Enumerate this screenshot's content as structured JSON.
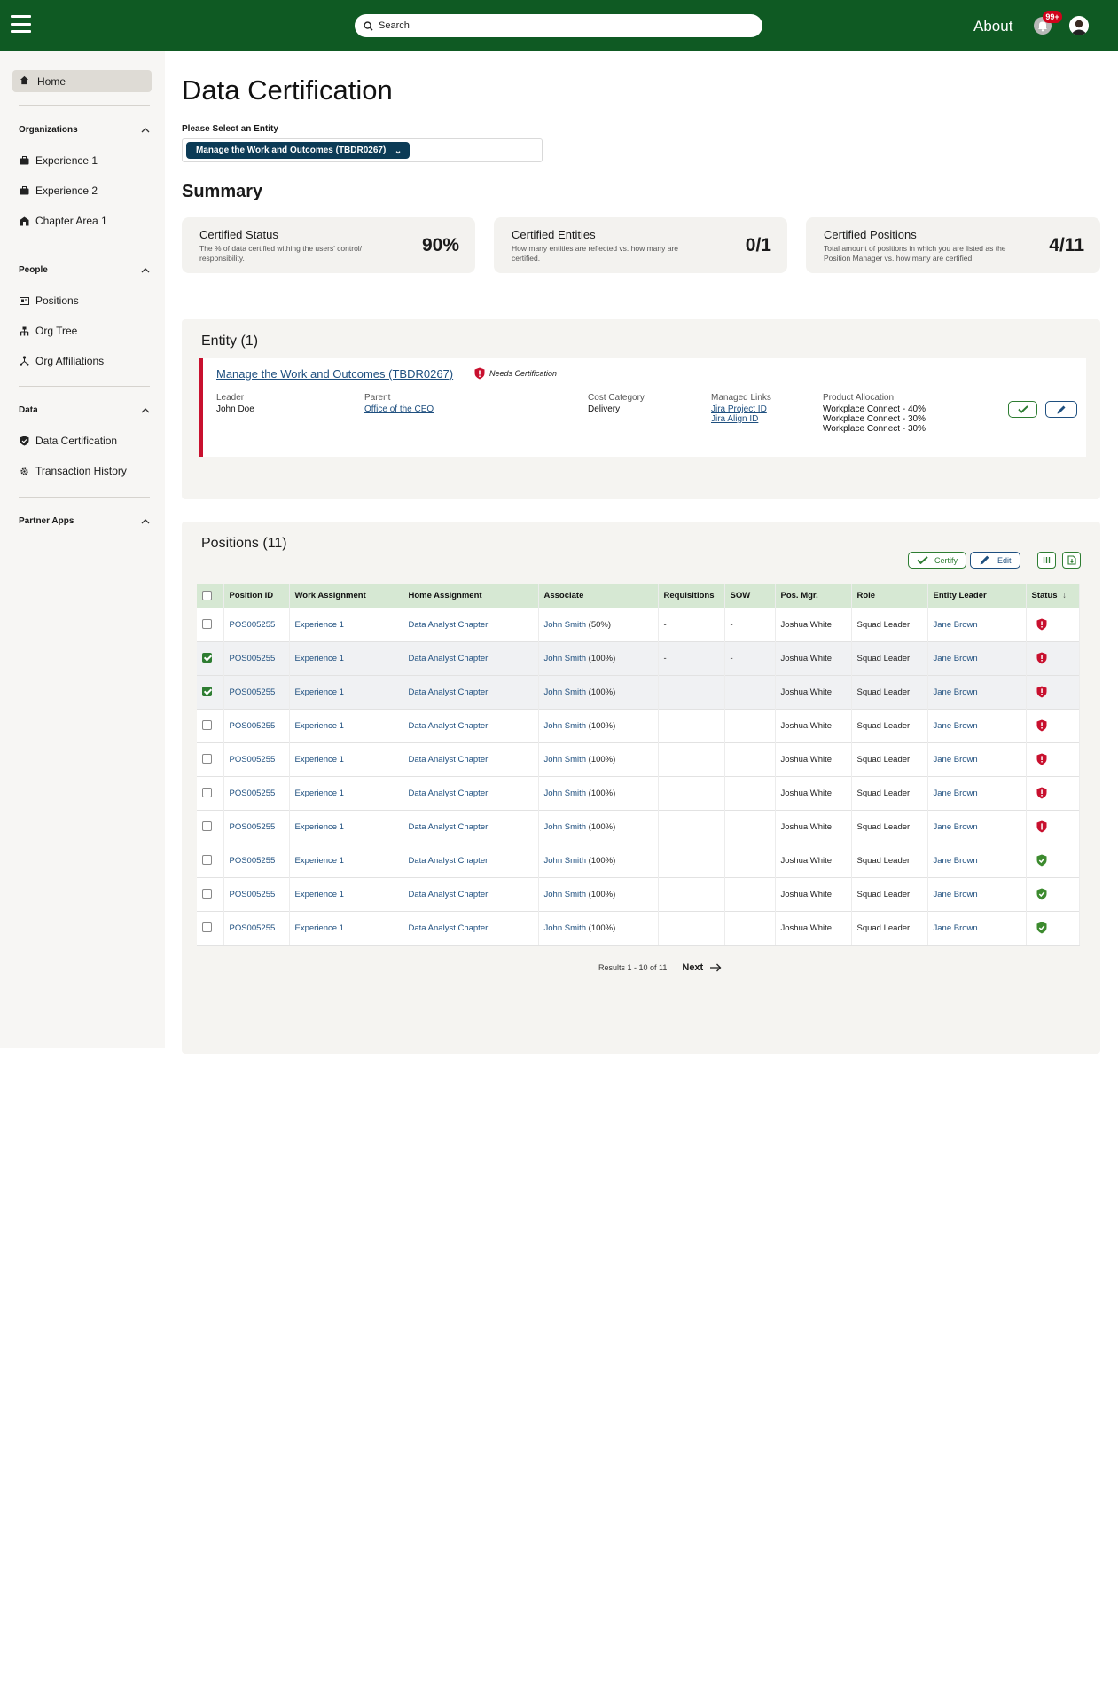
{
  "header": {
    "search_placeholder": "Search",
    "about_label": "About",
    "notification_count": "99+"
  },
  "sidebar": {
    "home_label": "Home",
    "sections": [
      {
        "title": "Organizations",
        "items": [
          "Experience 1",
          "Experience 2",
          "Chapter Area 1"
        ]
      },
      {
        "title": "People",
        "items": [
          "Positions",
          "Org Tree",
          "Org Affiliations"
        ]
      },
      {
        "title": "Data",
        "items": [
          "Data Certification",
          "Transaction History"
        ]
      },
      {
        "title": "Partner Apps",
        "items": []
      }
    ]
  },
  "page": {
    "title": "Data Certification",
    "select_label": "Please Select an Entity",
    "selected_entity": "Manage the Work and Outcomes (TBDR0267)"
  },
  "summary": {
    "title": "Summary",
    "cards": [
      {
        "title": "Certified Status",
        "desc": "The % of data certified withing the users' control/ responsibility.",
        "value": "90%"
      },
      {
        "title": "Certified Entities",
        "desc": "How many entities are reflected vs. how many are certified.",
        "value": "0/1"
      },
      {
        "title": "Certified Positions",
        "desc": "Total amount of positions in which you are listed as the Position Manager vs. how many are certified.",
        "value": "4/11"
      }
    ]
  },
  "entity": {
    "panel_title": "Entity (1)",
    "name": "Manage the Work and Outcomes (TBDR0267)",
    "status": "Needs Certification",
    "leader_label": "Leader",
    "leader": "John Doe",
    "parent_label": "Parent",
    "parent": "Office of the CEO",
    "cost_label": "Cost Category",
    "cost": "Delivery",
    "links_label": "Managed Links",
    "links": [
      "Jira Project ID",
      "Jira Align ID"
    ],
    "alloc_label": "Product Allocation",
    "allocations": [
      "Workplace Connect - 40%",
      "Workplace Connect - 30%",
      "Workplace Connect - 30%"
    ]
  },
  "positions": {
    "panel_title": "Positions (11)",
    "certify_label": "Certify",
    "edit_label": "Edit",
    "columns": [
      "Position ID",
      "Work Assignment",
      "Home Assignment",
      "Associate",
      "Requisitions",
      "SOW",
      "Pos. Mgr.",
      "Role",
      "Entity Leader",
      "Status"
    ],
    "rows": [
      {
        "checked": false,
        "id": "POS005255",
        "work": "Experience 1",
        "home": "Data Analyst Chapter",
        "assoc_name": "John Smith",
        "assoc_pct": "(50%)",
        "req": "-",
        "sow": "-",
        "mgr": "Joshua White",
        "role": "Squad Leader",
        "leader": "Jane Brown",
        "status": "needs"
      },
      {
        "checked": true,
        "id": "POS005255",
        "work": "Experience 1",
        "home": "Data Analyst Chapter",
        "assoc_name": "John Smith",
        "assoc_pct": "(100%)",
        "req": "-",
        "sow": "-",
        "mgr": "Joshua White",
        "role": "Squad Leader",
        "leader": "Jane Brown",
        "status": "needs"
      },
      {
        "checked": true,
        "id": "POS005255",
        "work": "Experience 1",
        "home": "Data Analyst Chapter",
        "assoc_name": "John Smith",
        "assoc_pct": "(100%)",
        "req": "",
        "sow": "",
        "mgr": "Joshua White",
        "role": "Squad Leader",
        "leader": "Jane Brown",
        "status": "needs"
      },
      {
        "checked": false,
        "id": "POS005255",
        "work": "Experience 1",
        "home": "Data Analyst Chapter",
        "assoc_name": "John Smith",
        "assoc_pct": "(100%)",
        "req": "",
        "sow": "",
        "mgr": "Joshua White",
        "role": "Squad Leader",
        "leader": "Jane Brown",
        "status": "needs"
      },
      {
        "checked": false,
        "id": "POS005255",
        "work": "Experience 1",
        "home": "Data Analyst Chapter",
        "assoc_name": "John Smith",
        "assoc_pct": "(100%)",
        "req": "",
        "sow": "",
        "mgr": "Joshua White",
        "role": "Squad Leader",
        "leader": "Jane Brown",
        "status": "needs"
      },
      {
        "checked": false,
        "id": "POS005255",
        "work": "Experience 1",
        "home": "Data Analyst Chapter",
        "assoc_name": "John Smith",
        "assoc_pct": "(100%)",
        "req": "",
        "sow": "",
        "mgr": "Joshua White",
        "role": "Squad Leader",
        "leader": "Jane Brown",
        "status": "needs"
      },
      {
        "checked": false,
        "id": "POS005255",
        "work": "Experience 1",
        "home": "Data Analyst Chapter",
        "assoc_name": "John Smith",
        "assoc_pct": "(100%)",
        "req": "",
        "sow": "",
        "mgr": "Joshua White",
        "role": "Squad Leader",
        "leader": "Jane Brown",
        "status": "needs"
      },
      {
        "checked": false,
        "id": "POS005255",
        "work": "Experience 1",
        "home": "Data Analyst Chapter",
        "assoc_name": "John Smith",
        "assoc_pct": "(100%)",
        "req": "",
        "sow": "",
        "mgr": "Joshua White",
        "role": "Squad Leader",
        "leader": "Jane Brown",
        "status": "certified"
      },
      {
        "checked": false,
        "id": "POS005255",
        "work": "Experience 1",
        "home": "Data Analyst Chapter",
        "assoc_name": "John Smith",
        "assoc_pct": "(100%)",
        "req": "",
        "sow": "",
        "mgr": "Joshua White",
        "role": "Squad Leader",
        "leader": "Jane Brown",
        "status": "certified"
      },
      {
        "checked": false,
        "id": "POS005255",
        "work": "Experience 1",
        "home": "Data Analyst Chapter",
        "assoc_name": "John Smith",
        "assoc_pct": "(100%)",
        "req": "",
        "sow": "",
        "mgr": "Joshua White",
        "role": "Squad Leader",
        "leader": "Jane Brown",
        "status": "certified"
      }
    ],
    "results_text": "Results 1 - 10 of 11",
    "next_label": "Next"
  },
  "colors": {
    "brand_green": "#0f5a23",
    "needs_red": "#c8102e",
    "certified_green": "#3c8a2e",
    "link_blue": "#1e4f7f",
    "header_row": "#d6e8d3"
  }
}
